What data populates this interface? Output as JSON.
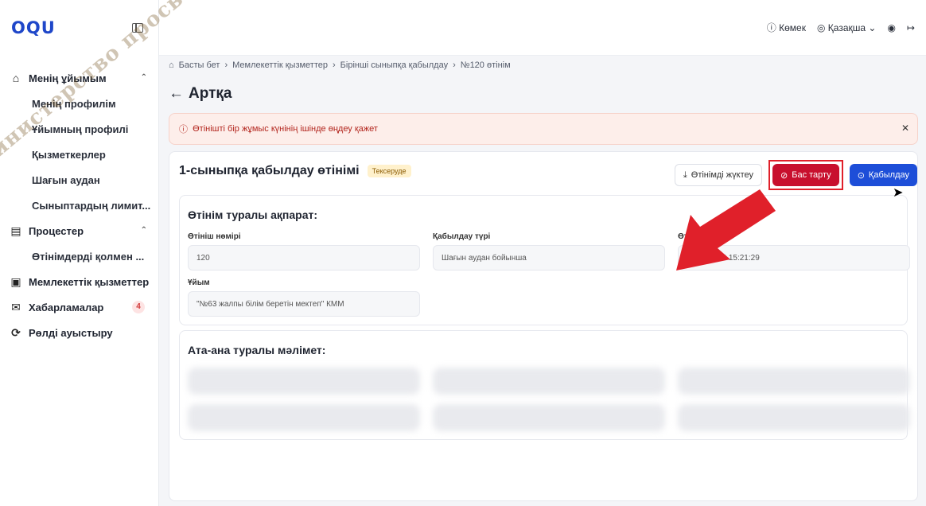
{
  "brand": {
    "logo_text": "OQU",
    "accent": "#1d4ed8",
    "danger": "#c8102e"
  },
  "topbar": {
    "help_label": "Көмек",
    "lang_label": "Қазақша"
  },
  "sidebar": {
    "groups": [
      {
        "label": "Менің ұйымым",
        "items": [
          "Менің профилім",
          "Ұйымның профилі",
          "Қызметкерлер",
          "Шағын аудан",
          "Сыныптардың лимит..."
        ]
      },
      {
        "label": "Процестер",
        "items": [
          "Өтінімдерді қолмен ..."
        ]
      }
    ],
    "single": [
      {
        "label": "Мемлекеттік қызметтер"
      },
      {
        "label": "Хабарламалар",
        "badge": "4"
      },
      {
        "label": "Рөлді ауыстыру"
      }
    ]
  },
  "breadcrumb": [
    "Басты бет",
    "Мемлекеттік қызметтер",
    "Бірінші сыныпқа қабылдау",
    "№120 өтінім"
  ],
  "back_label": "Артқа",
  "alert": {
    "text": "Өтінішті бір жұмыс күнінің ішінде өңдеу қажет"
  },
  "application": {
    "title": "1-сыныпқа қабылдау өтінімі",
    "status": "Тексеруде",
    "download_label": "Өтінімді жүктеу",
    "reject_label": "Бас тарту",
    "accept_label": "Қабылдау"
  },
  "info_section": {
    "title": "Өтінім туралы ақпарат:",
    "fields": [
      {
        "label": "Өтініш нөмірі",
        "value": "120"
      },
      {
        "label": "Қабылдау түрі",
        "value": "Шағын аудан бойынша"
      },
      {
        "label": "Өт",
        "value": "18.03.2026 15:21:29"
      },
      {
        "label": "Ұйым",
        "value": "\"№63 жалпы білім беретін мектеп\" КММ"
      }
    ]
  },
  "parent_section": {
    "title": "Ата-ана туралы мәлімет:"
  },
  "watermark": "Министерство просвещения"
}
